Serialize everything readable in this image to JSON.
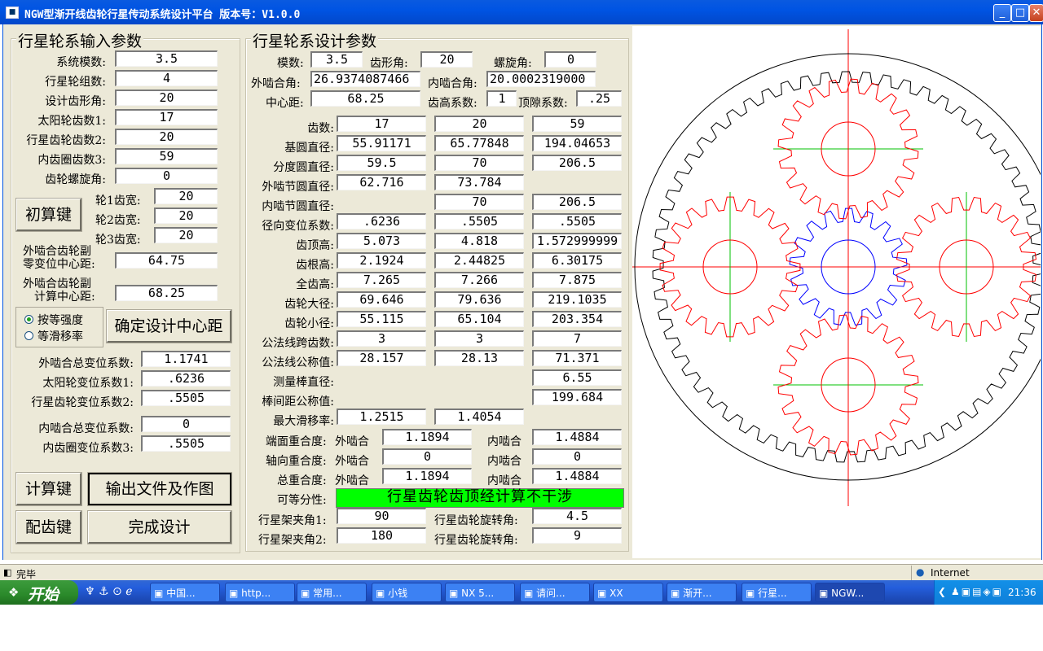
{
  "window": {
    "title": "NGW型渐开线齿轮行星传动系统设计平台   版本号：V1.0.0",
    "min": "_",
    "max": "□",
    "close": "✕"
  },
  "input_group": {
    "title": "行星轮系输入参数",
    "rows": [
      {
        "label": "系统模数:",
        "value": "3.5"
      },
      {
        "label": "行星轮组数:",
        "value": "4"
      },
      {
        "label": "设计齿形角:",
        "value": "20"
      },
      {
        "label": "太阳轮齿数1:",
        "value": "17"
      },
      {
        "label": "行星齿轮齿数2:",
        "value": "20"
      },
      {
        "label": "内齿圈齿数3:",
        "value": "59"
      },
      {
        "label": "齿轮螺旋角:",
        "value": "0"
      }
    ],
    "calc_init_btn": "初算键",
    "widths": [
      {
        "label": "轮1齿宽:",
        "value": "20"
      },
      {
        "label": "轮2齿宽:",
        "value": "20"
      },
      {
        "label": "轮3齿宽:",
        "value": "20"
      }
    ],
    "zero_center_label1": "外啮合齿轮副",
    "zero_center_label2": "零变位中心距:",
    "zero_center_value": "64.75",
    "calc_center_label1": "外啮合齿轮副",
    "calc_center_label2": "计算中心距:",
    "calc_center_value": "68.25",
    "radio_strength": "按等强度",
    "radio_slip": "等滑移率",
    "confirm_center_btn": "确定设计中心距",
    "shift_rows": [
      {
        "label": "外啮合总变位系数:",
        "value": "1.1741"
      },
      {
        "label": "太阳轮变位系数1:",
        "value": ".6236"
      },
      {
        "label": "行星齿轮变位系数2:",
        "value": ".5505"
      }
    ],
    "shift_rows2": [
      {
        "label": "内啮合总变位系数:",
        "value": "0"
      },
      {
        "label": "内齿圈变位系数3:",
        "value": ".5505"
      }
    ],
    "calc_btn": "计算键",
    "output_btn": "输出文件及作图",
    "match_btn": "配齿键",
    "finish_btn": "完成设计"
  },
  "design_group": {
    "title": "行星轮系设计参数",
    "module_label": "模数:",
    "module": "3.5",
    "angle_label": "齿形角:",
    "angle": "20",
    "helix_label": "螺旋角:",
    "helix": "0",
    "ext_mesh_label": "外啮合角:",
    "ext_mesh": "26.9374087466",
    "int_mesh_label": "内啮合角:",
    "int_mesh": "20.0002319000",
    "center_label": "中心距:",
    "center": "68.25",
    "addendum_coef_label": "齿高系数:",
    "addendum_coef": "1",
    "clearance_label": "顶隙系数:",
    "clearance": ".25",
    "rows": [
      {
        "label": "齿数:",
        "v": [
          "17",
          "20",
          "59"
        ]
      },
      {
        "label": "基圆直径:",
        "v": [
          "55.91171",
          "65.77848",
          "194.04653"
        ]
      },
      {
        "label": "分度圆直径:",
        "v": [
          "59.5",
          "70",
          "206.5"
        ]
      },
      {
        "label": "外啮节圆直径:",
        "v": [
          "62.716",
          "73.784",
          ""
        ]
      },
      {
        "label": "内啮节圆直径:",
        "v": [
          "",
          "70",
          "206.5"
        ]
      },
      {
        "label": "径向变位系数:",
        "v": [
          ".6236",
          ".5505",
          ".5505"
        ]
      },
      {
        "label": "齿顶高:",
        "v": [
          "5.073",
          "4.818",
          "1.572999999"
        ]
      },
      {
        "label": "齿根高:",
        "v": [
          "2.1924",
          "2.44825",
          "6.30175"
        ]
      },
      {
        "label": "全齿高:",
        "v": [
          "7.265",
          "7.266",
          "7.875"
        ]
      },
      {
        "label": "齿轮大径:",
        "v": [
          "69.646",
          "79.636",
          "219.1035"
        ]
      },
      {
        "label": "齿轮小径:",
        "v": [
          "55.115",
          "65.104",
          "203.354"
        ]
      },
      {
        "label": "公法线跨齿数:",
        "v": [
          "3",
          "3",
          "7"
        ]
      },
      {
        "label": "公法线公称值:",
        "v": [
          "28.157",
          "28.13",
          "71.371"
        ]
      },
      {
        "label": "测量棒直径:",
        "v": [
          "",
          "",
          "6.55"
        ]
      },
      {
        "label": "棒间距公称值:",
        "v": [
          "",
          "",
          "199.684"
        ]
      },
      {
        "label": "最大滑移率:",
        "v": [
          "1.2515",
          "1.4054",
          ""
        ]
      }
    ],
    "face_label": "端面重合度:",
    "axial_label": "轴向重合度:",
    "total_label": "总重合度:",
    "ext_word": "外啮合",
    "int_word": "内啮合",
    "face_ext": "1.1894",
    "face_int": "1.4884",
    "axial_ext": "0",
    "axial_int": "0",
    "total_ext": "1.1894",
    "total_int": "1.4884",
    "divisible_label": "可等分性:",
    "divisible_msg": "行星齿轮齿顶经计算不干涉",
    "carrier1_label": "行星架夹角1:",
    "carrier1": "90",
    "rot1_label": "行星齿轮旋转角:",
    "rot1": "4.5",
    "carrier2_label": "行星架夹角2:",
    "carrier2": "180",
    "rot2_label": "行星齿轮旋转角:",
    "rot2": "9"
  },
  "drawing": {
    "ring_teeth": 59,
    "sun_teeth": 17,
    "planet_teeth": 20,
    "planets": 4,
    "ring_color": "#000000",
    "sun_color": "#0000ff",
    "planet_color": "#ff0000",
    "axis_color": "#00c000",
    "center_axis_color": "#ff0000"
  },
  "status": {
    "text": "完毕",
    "zone": "Internet"
  },
  "taskbar": {
    "start": "开始",
    "tasks": [
      "中国...",
      "http...",
      "常用...",
      "小钱",
      "NX 5...",
      "请问...",
      "XX",
      "渐开...",
      "行星...",
      "NGW..."
    ],
    "clock": "21:36"
  }
}
